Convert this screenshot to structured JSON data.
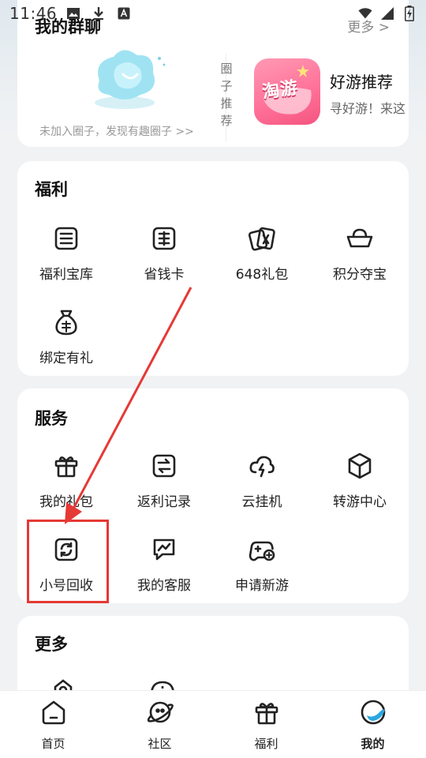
{
  "status_bar": {
    "time": "11:46"
  },
  "groups": {
    "title": "我的群聊",
    "more_label": "更多 >",
    "empty_text": "未加入圈子，发现有趣圈子 >>",
    "circle_recommend_label": "圈子推荐",
    "game": {
      "logo_text": "淘游",
      "name": "好游推荐",
      "desc": "寻好游！来这"
    }
  },
  "welfare": {
    "title": "福利",
    "items": [
      {
        "label": "福利宝库",
        "icon": "treasury-icon"
      },
      {
        "label": "省钱卡",
        "icon": "savings-card-icon"
      },
      {
        "label": "648礼包",
        "icon": "gift-card-icon"
      },
      {
        "label": "积分夺宝",
        "icon": "gold-ingot-icon"
      },
      {
        "label": "绑定有礼",
        "icon": "money-bag-icon"
      }
    ]
  },
  "service": {
    "title": "服务",
    "items": [
      {
        "label": "我的礼包",
        "icon": "gift-box-icon"
      },
      {
        "label": "返利记录",
        "icon": "rebate-record-icon"
      },
      {
        "label": "云挂机",
        "icon": "cloud-lightning-icon"
      },
      {
        "label": "转游中心",
        "icon": "cube-icon"
      },
      {
        "label": "小号回收",
        "icon": "recycle-icon"
      },
      {
        "label": "我的客服",
        "icon": "chat-trend-icon"
      },
      {
        "label": "申请新游",
        "icon": "gamepad-add-icon"
      }
    ]
  },
  "more": {
    "title": "更多"
  },
  "bottom_nav": [
    {
      "label": "首页",
      "icon": "home-icon"
    },
    {
      "label": "社区",
      "icon": "planet-icon"
    },
    {
      "label": "福利",
      "icon": "gift-icon"
    },
    {
      "label": "我的",
      "icon": "profile-icon",
      "active": true
    }
  ],
  "colors": {
    "annotation": "#e53935",
    "accent": "#2aa7e0"
  }
}
